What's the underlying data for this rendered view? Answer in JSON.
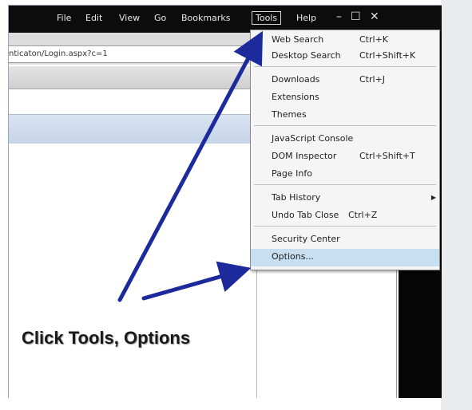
{
  "menubar": {
    "items": [
      "File",
      "Edit",
      "View",
      "Go",
      "Bookmarks",
      "Tools",
      "Help"
    ],
    "window_controls": [
      "–",
      "☐",
      "✕"
    ]
  },
  "address": {
    "url": "nticaton/Login.aspx?c=1"
  },
  "tools_menu": {
    "items": [
      {
        "label": "Web Search",
        "shortcut": "Ctrl+K"
      },
      {
        "label": "Desktop Search",
        "shortcut": "Ctrl+Shift+K"
      },
      {
        "label": "Downloads",
        "shortcut": "Ctrl+J"
      },
      {
        "label": "Extensions",
        "shortcut": ""
      },
      {
        "label": "Themes",
        "shortcut": ""
      },
      {
        "label": "JavaScript Console",
        "shortcut": ""
      },
      {
        "label": "DOM Inspector",
        "shortcut": "Ctrl+Shift+T"
      },
      {
        "label": "Page Info",
        "shortcut": ""
      },
      {
        "label": "Tab History",
        "shortcut": ""
      },
      {
        "label": "Undo Tab Close",
        "shortcut": "Ctrl+Z"
      },
      {
        "label": "Security Center",
        "shortcut": ""
      },
      {
        "label": "Options...",
        "shortcut": ""
      }
    ]
  },
  "caption": "Click Tools, Options",
  "colors": {
    "arrow": "#1c2a9c",
    "highlight": "#c7dff1",
    "menubar_bg": "#0c0c0c"
  }
}
